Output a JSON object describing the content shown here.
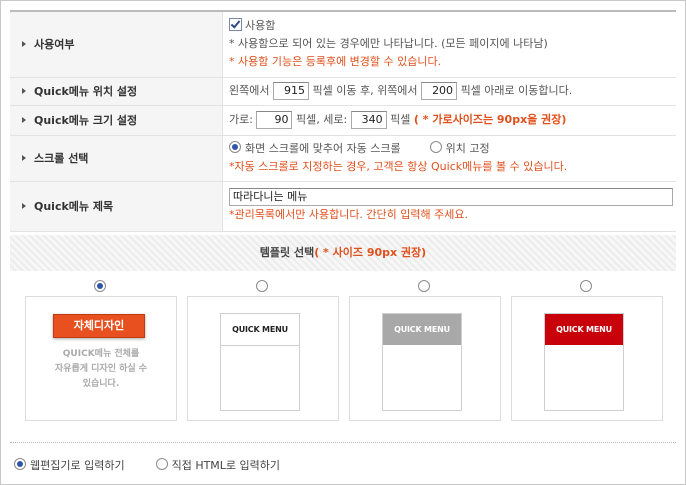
{
  "settings": {
    "use": {
      "label": "사용여부",
      "checkbox_label": "사용함",
      "note1": "* 사용함으로 되어 있는 경우에만 나타납니다. (모든 페이지에 나타남)",
      "note2": "* 사용함 기능은 등록후에 변경할 수 있습니다."
    },
    "position": {
      "label": "Quick메뉴 위치 설정",
      "prefix": "왼쪽에서",
      "left_value": "915",
      "middle": "픽셀 이동 후, 위쪽에서",
      "top_value": "200",
      "suffix": "픽셀 아래로 이동합니다."
    },
    "size": {
      "label": "Quick메뉴 크기 설정",
      "width_label": "가로:",
      "width_value": "90",
      "width_unit": "픽셀,",
      "height_label": "세로:",
      "height_value": "340",
      "height_unit": "픽셀",
      "note": "( * 가로사이즈는 90px을 권장)"
    },
    "scroll": {
      "label": "스크롤 선택",
      "option1": "화면 스크롤에 맞추어 자동 스크롤",
      "option2": "위치 고정",
      "note": "*자동 스크롤로 지정하는 경우, 고객은 항상 Quick메뉴를 볼 수 있습니다."
    },
    "title": {
      "label": "Quick메뉴 제목",
      "value": "따라다니는 메뉴",
      "note": "*관리목록에서만 사용합니다. 간단히 입력해 주세요."
    }
  },
  "template": {
    "heading": "템플릿 선택",
    "heading_note": "( * 사이즈 90px 권장)",
    "self_design_button": "자체디자인",
    "self_design_desc": [
      "QUICK메뉴 전체를",
      "자유롭게 디자인 하실 수",
      "있습니다."
    ],
    "quick_menu_label": "QUICK MENU",
    "selected_index": 0,
    "colors": {
      "accent": "#e8501f",
      "gray_header": "#a8a8a8",
      "red_header": "#c8000a"
    }
  },
  "mode": {
    "option1": "웹편집기로 입력하기",
    "option2": "직접 HTML로 입력하기",
    "selected": "option1"
  }
}
